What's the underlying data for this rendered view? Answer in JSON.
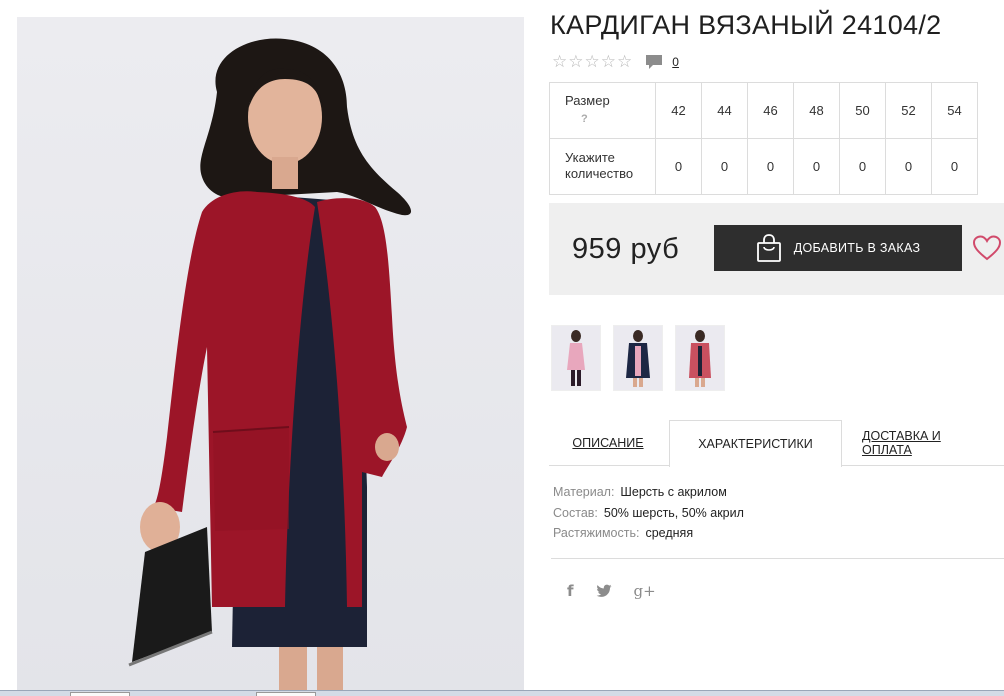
{
  "product": {
    "title": "КАРДИГАН ВЯЗАНЫЙ 24104/2",
    "rating_stars": [
      "☆",
      "☆",
      "☆",
      "☆",
      "☆"
    ],
    "review_count": "0",
    "price": "959 руб",
    "order_button": "ДОБАВИТЬ В ЗАКАЗ"
  },
  "size_table": {
    "size_label": "Размер",
    "help_mark": "?",
    "qty_label": "Укажите количество",
    "sizes": [
      "42",
      "44",
      "46",
      "48",
      "50",
      "52",
      "54"
    ],
    "quantities": [
      "0",
      "0",
      "0",
      "0",
      "0",
      "0",
      "0"
    ]
  },
  "thumbnails": [
    {
      "color": "pink"
    },
    {
      "color": "navy"
    },
    {
      "color": "red"
    }
  ],
  "tabs": {
    "description": "ОПИСАНИЕ",
    "specs": "ХАРАКТЕРИСТИКИ",
    "delivery": "ДОСТАВКА И ОПЛАТА"
  },
  "specs": [
    {
      "key": "Материал:",
      "value": "Шерсть с акрилом"
    },
    {
      "key": "Состав:",
      "value": "50% шерсть, 50% акрил"
    },
    {
      "key": "Растяжимость:",
      "value": "средняя"
    }
  ],
  "social": {
    "facebook": "f",
    "twitter": "🐦",
    "googleplus": "g+"
  },
  "colors": {
    "cardigan": "#9c1528",
    "dress": "#1c2236",
    "button": "#2e2e2e",
    "heart": "#d14a6b"
  }
}
